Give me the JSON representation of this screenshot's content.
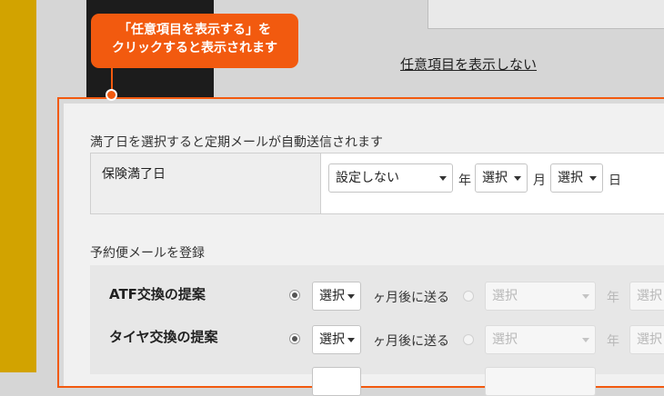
{
  "callout": {
    "line1": "「任意項目を表示する」を",
    "line2": "クリックすると表示されます"
  },
  "hide_link": "任意項目を表示しない",
  "section1": {
    "label": "満了日を選択すると定期メールが自動送信されます",
    "row_label": "保険満了日",
    "year_select": "設定しない",
    "year_unit": "年",
    "month_select": "選択",
    "month_unit": "月",
    "day_select": "選択",
    "day_unit": "日"
  },
  "section2": {
    "label": "予約便メールを登録",
    "rows": [
      {
        "title": "ATF交換の提案",
        "months_select": "選択",
        "months_text": "ヶ月後に送る",
        "date_select": "選択",
        "year_unit": "年",
        "month_select": "選択"
      },
      {
        "title": "タイヤ交換の提案",
        "months_select": "選択",
        "months_text": "ヶ月後に送る",
        "date_select": "選択",
        "year_unit": "年",
        "month_select": "選択"
      }
    ]
  },
  "colors": {
    "accent": "#f25a0f",
    "sidebar": "#d2a300"
  }
}
